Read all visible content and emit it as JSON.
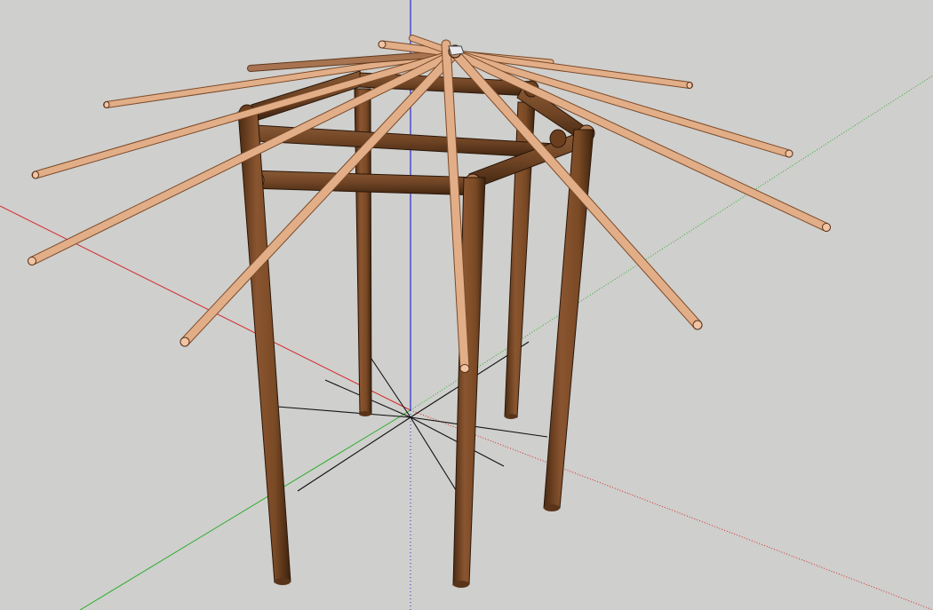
{
  "viewport": {
    "name": "3d-modeling-viewport",
    "background": "#cfcfcd"
  },
  "axes": {
    "red_axis_color": "#d42a2a",
    "green_axis_color": "#2fae2f",
    "blue_axis_color": "#2a2ad4"
  },
  "model": {
    "name": "octagonal-pole-gazebo-frame",
    "post_count": 6,
    "top_beam_count": 6,
    "rafter_count": 12,
    "post_color": "#7a4a25",
    "beam_color": "#6f4424",
    "rafter_color": "#d9a07a",
    "guide_line_color": "#111111"
  }
}
